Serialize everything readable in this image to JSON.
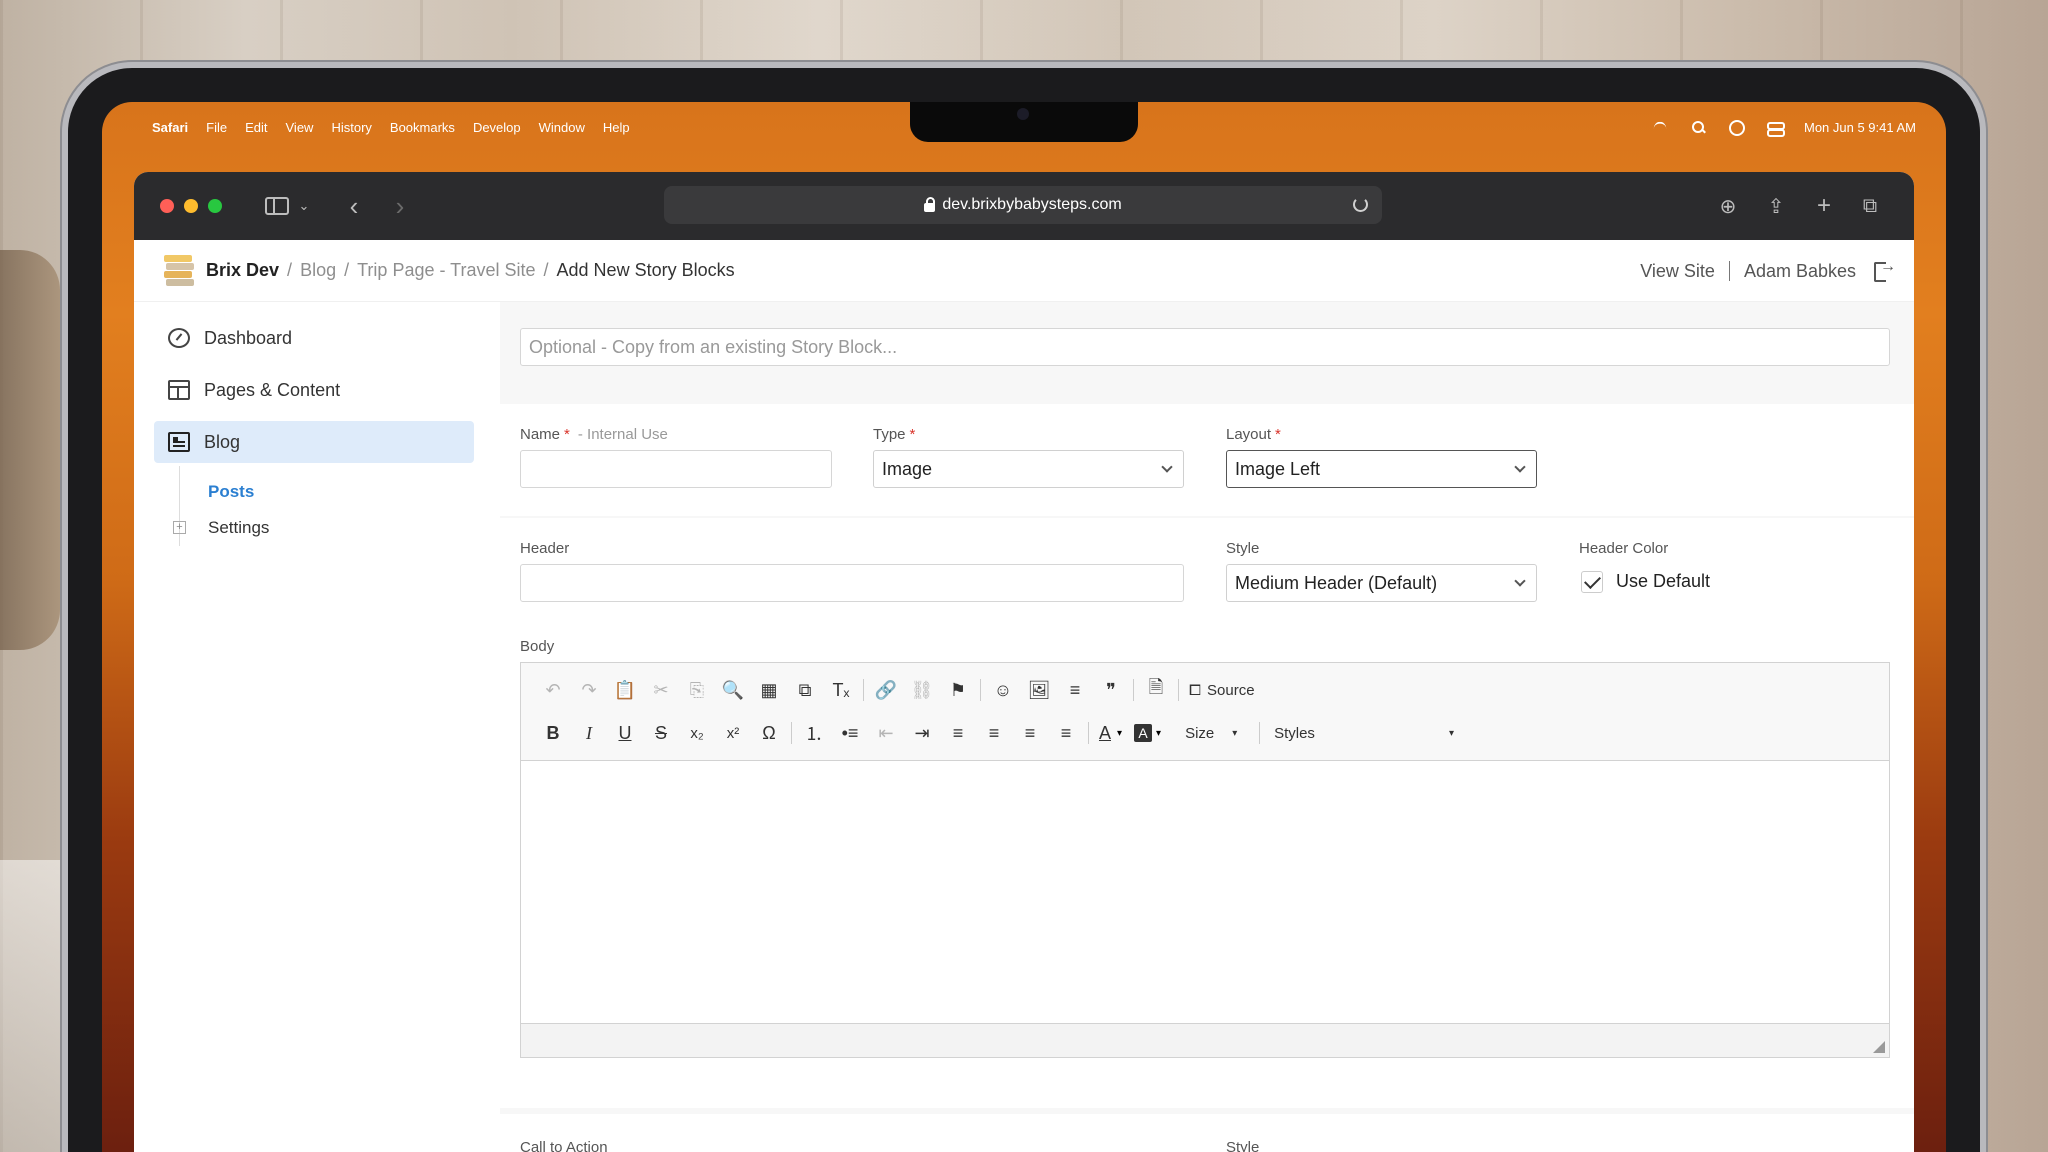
{
  "menubar": {
    "app": "Safari",
    "items": [
      "File",
      "Edit",
      "View",
      "History",
      "Bookmarks",
      "Develop",
      "Window",
      "Help"
    ],
    "clock": "Mon Jun 5  9:41 AM"
  },
  "browser": {
    "url": "dev.brixbybabysteps.com"
  },
  "topnav": {
    "site": "Brix Dev",
    "crumb_blog": "Blog",
    "crumb_trip": "Trip Page - Travel Site",
    "crumb_current": "Add New Story Blocks",
    "separator": "/",
    "view_site": "View Site",
    "user": "Adam Babkes"
  },
  "sidebar": {
    "items": [
      {
        "label": "Dashboard"
      },
      {
        "label": "Pages & Content"
      },
      {
        "label": "Blog"
      }
    ],
    "sub_posts": "Posts",
    "sub_settings": "Settings",
    "plus": "+"
  },
  "form": {
    "copy_placeholder": "Optional - Copy from an existing Story Block...",
    "name_label": "Name",
    "name_hint": "- Internal Use",
    "required_mark": "*",
    "type_label": "Type",
    "type_value": "Image",
    "layout_label": "Layout",
    "layout_value": "Image Left",
    "header_label": "Header",
    "style_label": "Style",
    "style_value": "Medium Header (Default)",
    "header_color_label": "Header Color",
    "use_default_label": "Use Default",
    "body_label": "Body",
    "cta_label": "Call to Action",
    "cta_style_label": "Style"
  },
  "editor": {
    "source_label": "Source",
    "size_label": "Size",
    "styles_label": "Styles",
    "glyphs": {
      "undo": "↶",
      "redo": "↷",
      "paste": "📋",
      "cut": "✂",
      "copy": "⎘",
      "find": "🔍",
      "select_all": "▦",
      "replace": "⧉",
      "clear_format": "Tₓ",
      "link": "🔗",
      "unlink": "⛓",
      "anchor": "⚑",
      "emoji": "☺",
      "image": "🖼",
      "hr": "≡",
      "quote": "❞",
      "template": "🗎",
      "source_glyph": "⧠",
      "bold": "B",
      "italic": "I",
      "underline": "U",
      "strike": "S",
      "subscript": "x₂",
      "superscript": "x²",
      "omega": "Ω",
      "ol": "⒈",
      "ul": "•≡",
      "outdent": "⇤",
      "indent": "⇥",
      "align_left": "≡",
      "align_center": "≡",
      "align_right": "≡",
      "justify": "≡",
      "text_color": "A",
      "bg_color": "A",
      "caret": "▾"
    }
  }
}
